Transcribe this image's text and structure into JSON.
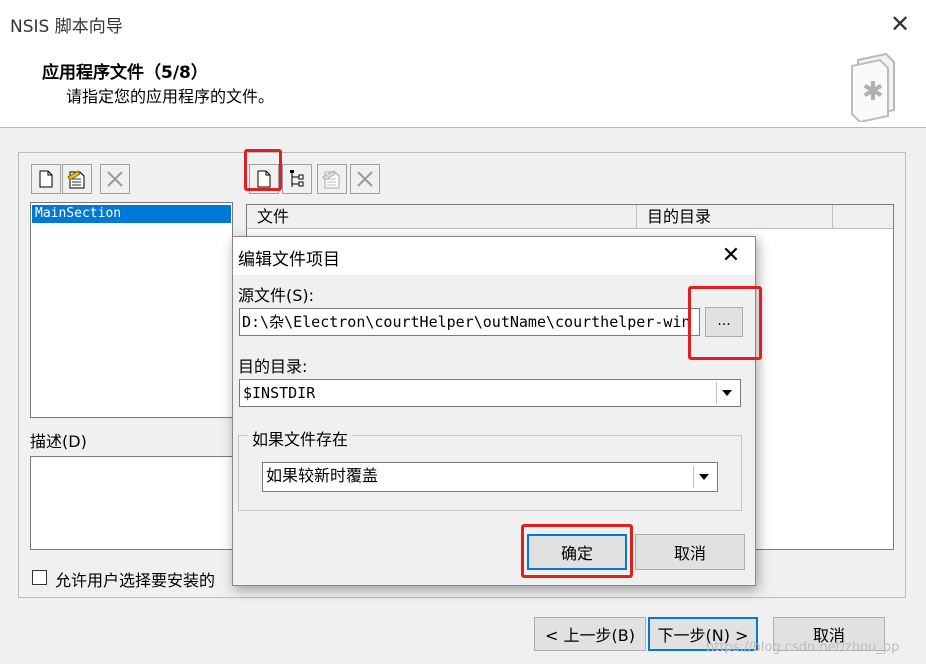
{
  "window": {
    "title": "NSIS 脚本向导",
    "close_symbol": "✕"
  },
  "header": {
    "title": "应用程序文件（5/8）",
    "subtitle": "请指定您的应用程序的文件。",
    "icon": "wizard-document-icon"
  },
  "sections": {
    "items": [
      "MainSection"
    ],
    "selected_index": 0,
    "toolbar_icons": [
      "new-section-icon",
      "edit-section-icon",
      "delete-section-icon"
    ]
  },
  "description": {
    "label": "描述(D)",
    "value": ""
  },
  "allow_select": {
    "label": "允许用户选择要安装的",
    "checked": false
  },
  "files": {
    "toolbar_icons": [
      "add-file-icon",
      "add-directory-icon",
      "edit-file-icon",
      "delete-file-icon"
    ],
    "columns": [
      "文件",
      "目的目录"
    ]
  },
  "dialog": {
    "title": "编辑文件项目",
    "close_symbol": "✕",
    "source_label": "源文件(S):",
    "source_value": "D:\\杂\\Electron\\courtHelper\\outName\\courthelper-win",
    "browse_label": "...",
    "dest_label": "目的目录:",
    "dest_value": "$INSTDIR",
    "exists_group_label": "如果文件存在",
    "exists_value": "如果较新时覆盖",
    "ok_label": "确定",
    "cancel_label": "取消"
  },
  "navigation": {
    "back_label": "< 上一步(B)",
    "next_label": "下一步(N) >",
    "cancel_label": "取消"
  },
  "watermark": "https://blog.csdn.net/zhou_pp",
  "colors": {
    "selection": "#0078d7",
    "highlight_box": "#e0201e"
  }
}
